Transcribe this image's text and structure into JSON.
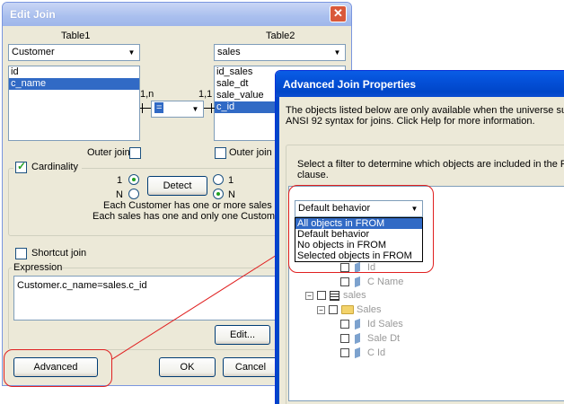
{
  "edit_join": {
    "title": "Edit Join",
    "close_glyph": "✕",
    "table1_label": "Table1",
    "table2_label": "Table2",
    "table1_select": "Customer",
    "table2_select": "sales",
    "table1_columns": [
      "id",
      "c_name"
    ],
    "table1_selected_index": 1,
    "table2_columns": [
      "id_sales",
      "sale_dt",
      "sale_value",
      "c_id"
    ],
    "table2_selected_index": 3,
    "card_left": "1,n",
    "card_right": "1,1",
    "operator": "=",
    "outer_join_label": "Outer join",
    "cardinality_label": "Cardinality",
    "cardinality_checked": true,
    "left_opt_1": "1",
    "left_opt_n": "N",
    "right_opt_1": "1",
    "right_opt_n": "N",
    "detect_label": "Detect",
    "desc_line1": "Each Customer has one or more sales",
    "desc_line2": "Each sales has one and only one Customer",
    "shortcut_join_label": "Shortcut join",
    "expression_label": "Expression",
    "expression_value": "Customer.c_name=sales.c_id",
    "edit_label": "Edit...",
    "advanced_label": "Advanced",
    "ok_label": "OK",
    "cancel_label": "Cancel"
  },
  "advanced_join": {
    "title": "Advanced Join Properties",
    "info_line1": "The objects listed below are only available when the universe supports",
    "info_line2": "ANSI 92 syntax for joins. Click Help for more information.",
    "filter_line1": "Select a filter to determine which objects are included in the FROM",
    "filter_line2": "clause.",
    "selected_filter": "Default behavior",
    "filter_options": [
      "All objects in FROM",
      "Default behavior",
      "No objects in FROM",
      "Selected objects in FROM"
    ],
    "highlighted_option_index": 0,
    "tree": {
      "customer_items": [
        "Id",
        "C Name"
      ],
      "sales_table": "sales",
      "sales_class": "Sales",
      "sales_items": [
        "Id Sales",
        "Sale Dt",
        "C Id"
      ]
    }
  },
  "colors": {
    "annotation": "#e02020",
    "selection": "#316ac5",
    "xp_title": "#0046c8"
  }
}
